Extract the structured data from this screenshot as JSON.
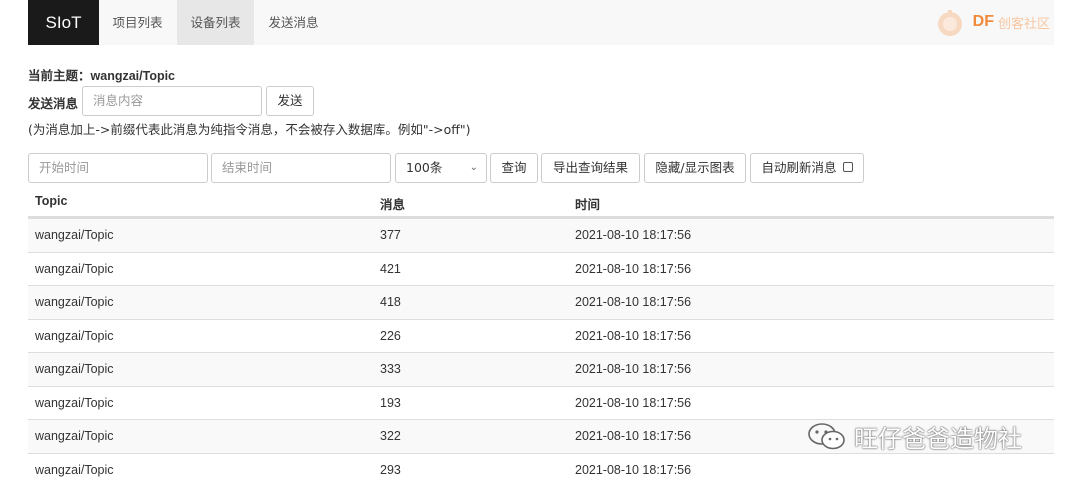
{
  "navbar": {
    "brand": "SIoT",
    "items": [
      {
        "label": "项目列表",
        "active": false
      },
      {
        "label": "设备列表",
        "active": true
      },
      {
        "label": "发送消息",
        "active": false
      }
    ],
    "logo_text": "DF",
    "logo_sub": "创客社区"
  },
  "topic": {
    "label": "当前主题：",
    "value": "wangzai/Topic"
  },
  "send": {
    "label": "发送消息",
    "placeholder": "消息内容",
    "button": "发送",
    "hint": "(为消息加上->前缀代表此消息为纯指令消息，不会被存入数据库。例如\"->off\")"
  },
  "query": {
    "start_placeholder": "开始时间",
    "end_placeholder": "结束时间",
    "limit_value": "100条",
    "query_button": "查询",
    "export_button": "导出查询结果",
    "toggle_chart_button": "隐藏/显示图表",
    "auto_refresh_label": "自动刷新消息"
  },
  "table": {
    "headers": [
      "Topic",
      "消息",
      "时间"
    ],
    "rows": [
      [
        "wangzai/Topic",
        "377",
        "2021-08-10 18:17:56"
      ],
      [
        "wangzai/Topic",
        "421",
        "2021-08-10 18:17:56"
      ],
      [
        "wangzai/Topic",
        "418",
        "2021-08-10 18:17:56"
      ],
      [
        "wangzai/Topic",
        "226",
        "2021-08-10 18:17:56"
      ],
      [
        "wangzai/Topic",
        "333",
        "2021-08-10 18:17:56"
      ],
      [
        "wangzai/Topic",
        "193",
        "2021-08-10 18:17:56"
      ],
      [
        "wangzai/Topic",
        "322",
        "2021-08-10 18:17:56"
      ],
      [
        "wangzai/Topic",
        "293",
        "2021-08-10 18:17:56"
      ]
    ]
  },
  "watermark": {
    "text": "旺仔爸爸造物社",
    "icon": "wechat-icon"
  },
  "colors": {
    "brand_bg": "#1a1a1a",
    "navbar_bg": "#f8f8f8",
    "active_tab_bg": "#e7e7e7",
    "row_stripe": "#f9f9f9",
    "logo_orange": "#f08a3c"
  }
}
